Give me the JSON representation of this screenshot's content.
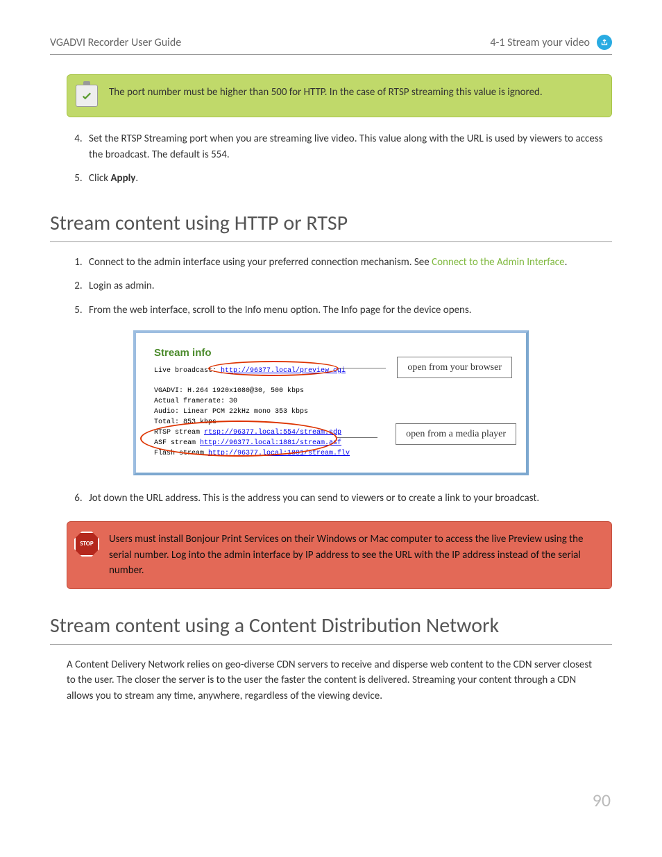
{
  "header": {
    "left": "VGADVI Recorder User Guide",
    "right": "4-1 Stream your video"
  },
  "note": {
    "text": "The port number must be higher than 500 for HTTP. In the case of RTSP streaming this value is ignored."
  },
  "steps_a": {
    "item4": "Set the RTSP Streaming port when you are streaming live video. This value along with the URL is used by viewers to access the broadcast. The default is 554.",
    "item5_pre": "Click ",
    "item5_bold": "Apply",
    "item5_post": "."
  },
  "heading1": "Stream content using HTTP or RTSP",
  "steps_b": {
    "item1_pre": "Connect to the admin interface using your preferred connection mechanism. See ",
    "item1_link": "Connect to the Admin Interface",
    "item1_post": ".",
    "item2": "Login as admin.",
    "item5": "From the web interface, scroll to the Info menu option. The Info page for the device opens.",
    "item6": "Jot down the URL address. This is the address you can send to viewers or to create a link to your broadcast."
  },
  "screenshot": {
    "heading": "Stream info",
    "live_label": "Live broadcast: ",
    "live_url": "http://96377.local/preview.cgi",
    "line1": "VGADVI: H.264 1920x1080@30, 500 kbps",
    "line2": "Actual framerate: 30",
    "line3": "Audio: Linear PCM 22kHz mono 353 kbps",
    "line4": "Total: 853 kbps",
    "rtsp_label": "RTSP stream ",
    "rtsp_url": "rtsp://96377.local:554/stream.sdp",
    "asf_label": "ASF stream ",
    "asf_url": "http://96377.local:1881/stream.asf",
    "flash_label": "Flash stream ",
    "flash_url": "http://96377.local:1881/stream.flv",
    "callout1": "open from your browser",
    "callout2": "open from a media player"
  },
  "stop": {
    "badge": "STOP",
    "text": "Users must install Bonjour Print Services on their Windows or Mac computer to access the live Preview using the serial number. Log into the admin interface by IP address to see the URL with the IP address instead of the serial number."
  },
  "heading2": "Stream content using a Content Distribution Network",
  "cdn_para": "A Content Delivery Network relies on geo-diverse CDN servers to receive and disperse web content to the CDN server closest to the user. The closer the server is to the user the faster the content is delivered. Streaming your content through a CDN allows you to stream any time, anywhere, regardless of the viewing device.",
  "page_number": "90"
}
